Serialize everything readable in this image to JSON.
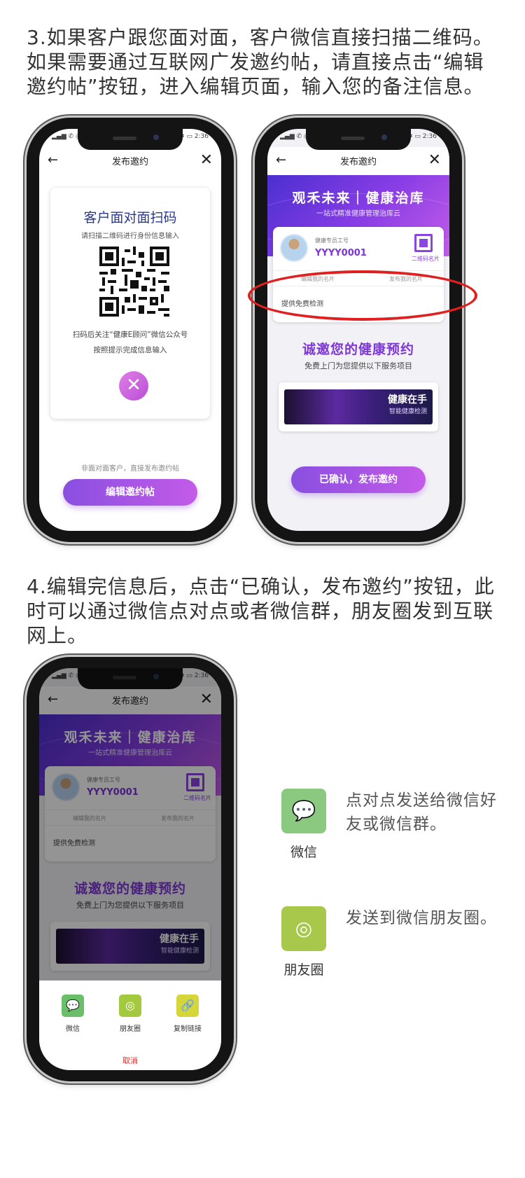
{
  "step3": {
    "text": "3.如果客户跟您面对面，客户微信直接扫描二维码。如果需要通过互联网广发邀约帖，请直接点击“编辑邀约帖”按钮，进入编辑页面，输入您的备注信息。"
  },
  "step4": {
    "text": "4.编辑完信息后，点击“已确认，发布邀约”按钮，此时可以通过微信点对点或者微信群，朋友圈发到互联网上。"
  },
  "phone_common": {
    "nav_title": "发布邀约",
    "back_icon": "←",
    "close_icon": "✕",
    "status_left": "▂▄▆ ✆ ◎",
    "status_right": "✱ ▭ 2:36"
  },
  "phone1": {
    "card_title": "客户面对面扫码",
    "card_subtitle": "请扫描二维码进行身份信息输入",
    "line1": "扫码后关注“健康E顾问”微信公众号",
    "line2": "按照提示完成信息输入",
    "close_symbol": "✕",
    "bottom_note": "非面对面客户，直接发布邀约帖",
    "button": "编辑邀约帖"
  },
  "phone2": {
    "banner_title": "观禾未来｜健康治库",
    "banner_subtitle": "一站式精准健康管理治库云",
    "label": "健康专员工号",
    "user_id": "YYYY0001",
    "qr_label": "二维码名片",
    "tab_left": "编辑我的名片",
    "tab_right": "发布我的名片",
    "service": "提供免费检测",
    "invite_title": "诚邀您的健康预约",
    "invite_sub": "免费上门为您提供以下服务项目",
    "promo_title": "健康在手",
    "promo_sub": "智能健康检测",
    "button": "已确认，发布邀约"
  },
  "sheet": {
    "options": [
      {
        "label": "微信",
        "icon": "wechat-icon",
        "color": "#6cbf6a"
      },
      {
        "label": "朋友圈",
        "icon": "moments-icon",
        "color": "#a3c93e"
      },
      {
        "label": "复制链接",
        "icon": "link-icon",
        "color": "#d6d53a"
      }
    ],
    "cancel": "取消"
  },
  "share_info": [
    {
      "label": "微信",
      "desc": "点对点发送给微信好友或微信群。",
      "icon": "wechat-icon",
      "color": "#8bc980"
    },
    {
      "label": "朋友圈",
      "desc": "发送到微信朋友圈。",
      "icon": "moments-icon",
      "color": "#a7c84a"
    }
  ],
  "colors": {
    "accent": "#8a46e0",
    "highlight_ring": "#e02020",
    "title_blue": "#2a3a8f"
  }
}
